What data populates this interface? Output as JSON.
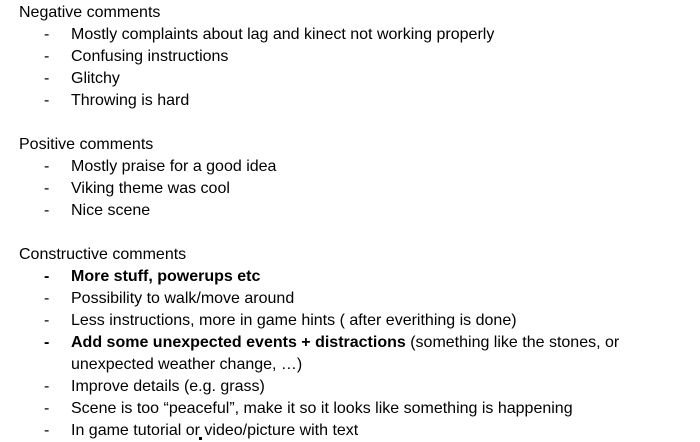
{
  "sections": [
    {
      "heading": "Negative comments",
      "items": [
        {
          "text": "Mostly complaints about lag and kinect not working properly"
        },
        {
          "text": "Confusing instructions"
        },
        {
          "text": "Glitchy"
        },
        {
          "text": "Throwing is hard"
        }
      ]
    },
    {
      "heading": "Positive comments",
      "items": [
        {
          "text": "Mostly praise for a good idea"
        },
        {
          "text": "Viking theme was cool"
        },
        {
          "text": "Nice scene"
        }
      ]
    },
    {
      "heading": "Constructive comments",
      "items": [
        {
          "bold_text": "More stuff, powerups etc",
          "text": ""
        },
        {
          "text": "Possibility to walk/move around"
        },
        {
          "text": "Less instructions, more in game hints ( after everithing is done)"
        },
        {
          "bold_text": "Add some unexpected events + distractions",
          "text": " (something like the stones, or unexpected weather change, …)"
        },
        {
          "text": "Improve details (e.g. grass)"
        },
        {
          "text": "Scene is too “peaceful”, make it so it looks like something is happening"
        },
        {
          "text": "In game tutorial or video/picture with text"
        }
      ]
    }
  ],
  "bullet_marker": "-"
}
